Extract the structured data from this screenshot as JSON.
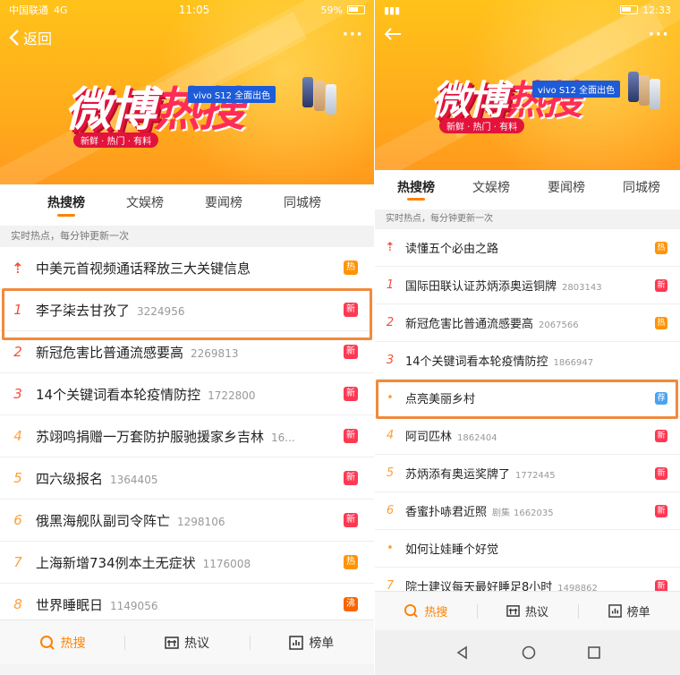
{
  "left": {
    "status": {
      "carrier": "中国联通",
      "network": "4G",
      "time": "11:05",
      "battery": "59%"
    },
    "nav": {
      "back_label": "返回",
      "more": "···"
    },
    "banner": {
      "logo_main": "微博",
      "logo_hot": "热搜",
      "tagline": "新鲜 · 热门 · 有料",
      "sponsor": "vivo S12 全面出色"
    },
    "tabs": [
      "热搜榜",
      "文娱榜",
      "要闻榜",
      "同城榜"
    ],
    "subheading": "实时热点，每分钟更新一次",
    "rows": [
      {
        "rank": "⇡",
        "title": "中美元首视频通话释放三大关键信息",
        "count": "",
        "badge": "热",
        "badge_type": "hot"
      },
      {
        "rank": "1",
        "title": "李子柒去甘孜了",
        "count": "3224956",
        "badge": "新",
        "badge_type": "new"
      },
      {
        "rank": "2",
        "title": "新冠危害比普通流感要高",
        "count": "2269813",
        "badge": "新",
        "badge_type": "new"
      },
      {
        "rank": "3",
        "title": "14个关键词看本轮疫情防控",
        "count": "1722800",
        "badge": "新",
        "badge_type": "new"
      },
      {
        "rank": "4",
        "title": "苏翊鸣捐赠一万套防护服驰援家乡吉林",
        "count": "16...",
        "badge": "新",
        "badge_type": "new"
      },
      {
        "rank": "5",
        "title": "四六级报名",
        "count": "1364405",
        "badge": "新",
        "badge_type": "new"
      },
      {
        "rank": "6",
        "title": "俄黑海舰队副司令阵亡",
        "count": "1298106",
        "badge": "新",
        "badge_type": "new"
      },
      {
        "rank": "7",
        "title": "上海新增734例本土无症状",
        "count": "1176008",
        "badge": "热",
        "badge_type": "hot"
      },
      {
        "rank": "8",
        "title": "世界睡眠日",
        "count": "1149056",
        "badge": "沸",
        "badge_type": "boil"
      }
    ],
    "bottom": [
      {
        "label": "热搜",
        "icon": "hot-search-icon"
      },
      {
        "label": "热议",
        "icon": "discussion-icon"
      },
      {
        "label": "榜单",
        "icon": "chart-icon"
      }
    ]
  },
  "right": {
    "status": {
      "time": "12:33"
    },
    "nav": {
      "more": "···"
    },
    "banner": {
      "logo_main": "微博",
      "logo_hot": "热搜",
      "tagline": "新鲜 · 热门 · 有料",
      "sponsor": "vivo S12 全面出色"
    },
    "tabs": [
      "热搜榜",
      "文娱榜",
      "要闻榜",
      "同城榜"
    ],
    "subheading": "实时热点，每分钟更新一次",
    "rows": [
      {
        "rank": "⇡",
        "title": "读懂五个必由之路",
        "category": "",
        "count": "",
        "badge": "热",
        "badge_type": "hot"
      },
      {
        "rank": "1",
        "title": "国际田联认证苏炳添奥运铜牌",
        "category": "",
        "count": "2803143",
        "badge": "新",
        "badge_type": "new"
      },
      {
        "rank": "2",
        "title": "新冠危害比普通流感要高",
        "category": "",
        "count": "2067566",
        "badge": "热",
        "badge_type": "hot"
      },
      {
        "rank": "3",
        "title": "14个关键词看本轮疫情防控",
        "category": "",
        "count": "1866947",
        "badge": "",
        "badge_type": ""
      },
      {
        "rank": "•",
        "title": "点亮美丽乡村",
        "category": "",
        "count": "",
        "badge": "荐",
        "badge_type": "rec"
      },
      {
        "rank": "4",
        "title": "阿司匹林",
        "category": "",
        "count": "1862404",
        "badge": "新",
        "badge_type": "new"
      },
      {
        "rank": "5",
        "title": "苏炳添有奥运奖牌了",
        "category": "",
        "count": "1772445",
        "badge": "新",
        "badge_type": "new"
      },
      {
        "rank": "6",
        "title": "香蜜扑哧君近照",
        "category": "剧集",
        "count": "1662035",
        "badge": "新",
        "badge_type": "new"
      },
      {
        "rank": "•",
        "title": "如何让娃睡个好觉",
        "category": "",
        "count": "",
        "badge": "",
        "badge_type": ""
      },
      {
        "rank": "7",
        "title": "院士建议每天最好睡足8小时",
        "category": "",
        "count": "1498862",
        "badge": "新",
        "badge_type": "new"
      }
    ],
    "bottom": [
      {
        "label": "热搜",
        "icon": "hot-search-icon"
      },
      {
        "label": "热议",
        "icon": "discussion-icon"
      },
      {
        "label": "榜单",
        "icon": "chart-icon"
      }
    ]
  },
  "colors": {
    "accent": "#ff8200",
    "new": "#ff3852",
    "hot": "#ff9406",
    "recommend": "#4aa3f2",
    "highlight": "#f08a3c"
  }
}
